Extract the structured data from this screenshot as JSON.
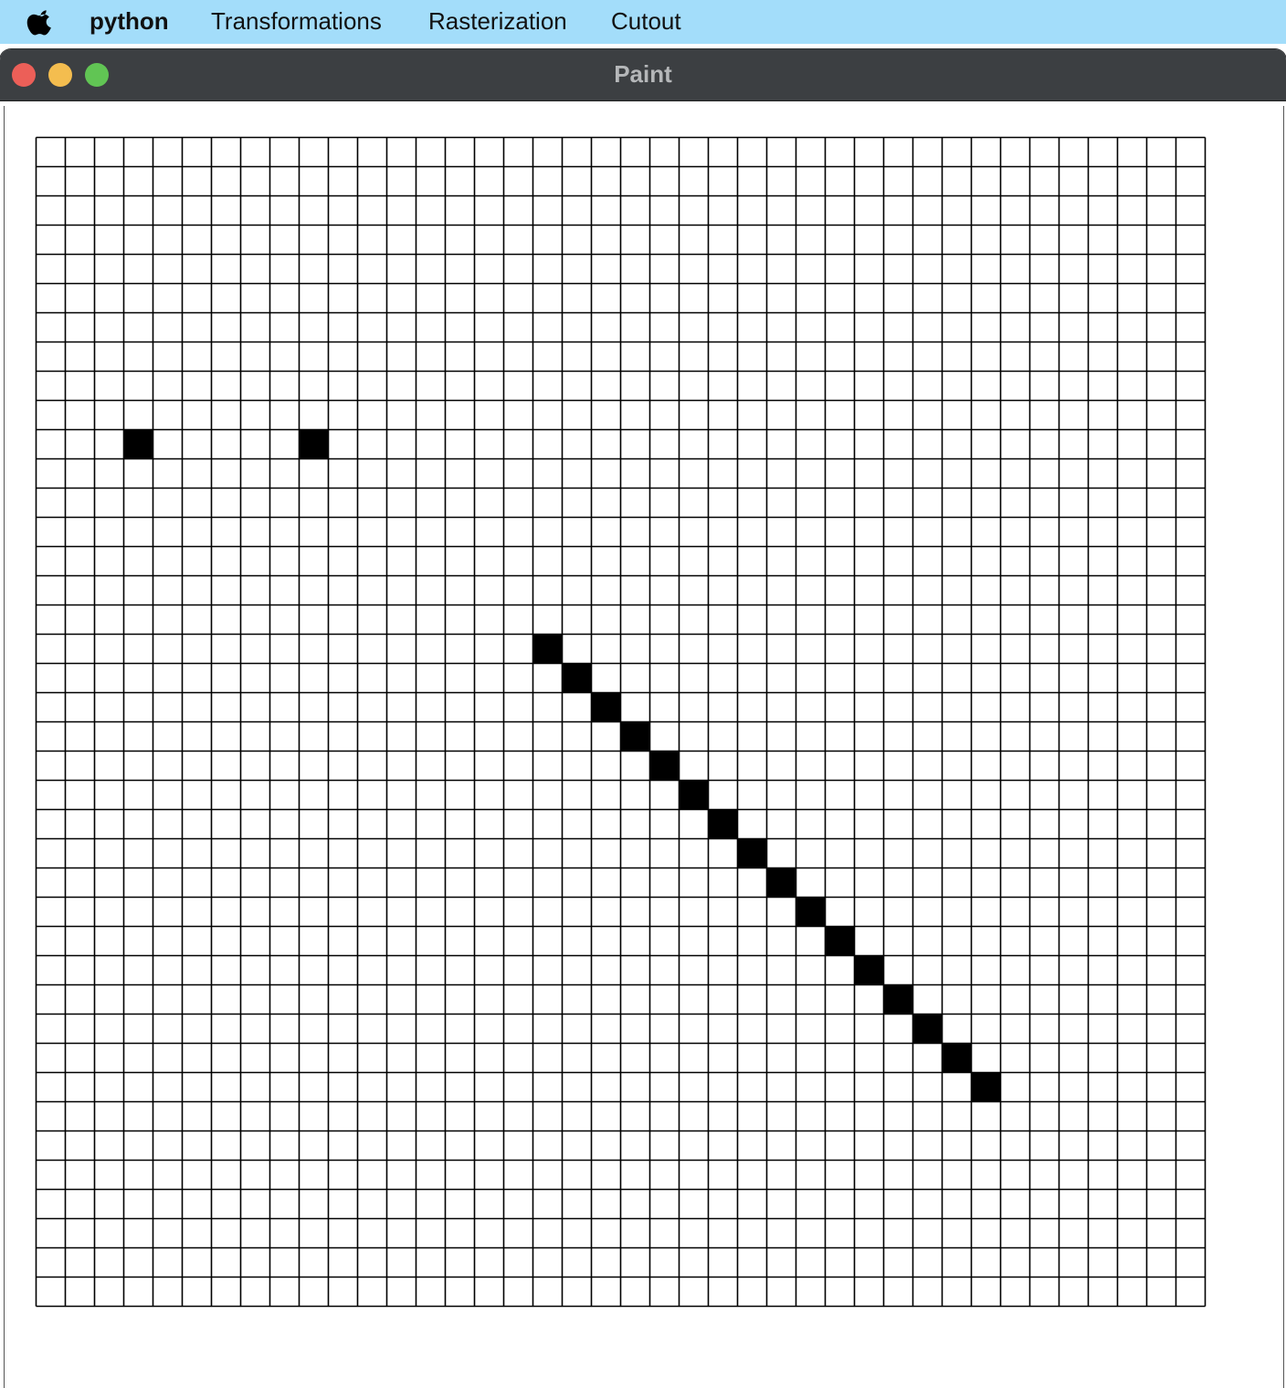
{
  "menubar": {
    "apple_icon": "apple-logo-icon",
    "app_name": "python",
    "menus": [
      "Transformations",
      "Rasterization",
      "Cutout"
    ]
  },
  "window": {
    "title": "Paint",
    "traffic_lights": {
      "close_color": "#ec5f58",
      "minimize_color": "#f4bd4f",
      "maximize_color": "#61c554"
    }
  },
  "canvas": {
    "grid_columns": 40,
    "grid_rows": 40,
    "background_color": "#ffffff",
    "grid_line_color": "#000000",
    "fill_color": "#000000",
    "filled_cells": [
      {
        "col": 3,
        "row": 10
      },
      {
        "col": 9,
        "row": 10
      },
      {
        "col": 17,
        "row": 17
      },
      {
        "col": 18,
        "row": 18
      },
      {
        "col": 19,
        "row": 19
      },
      {
        "col": 20,
        "row": 20
      },
      {
        "col": 21,
        "row": 21
      },
      {
        "col": 22,
        "row": 22
      },
      {
        "col": 23,
        "row": 23
      },
      {
        "col": 24,
        "row": 24
      },
      {
        "col": 25,
        "row": 25
      },
      {
        "col": 26,
        "row": 26
      },
      {
        "col": 27,
        "row": 27
      },
      {
        "col": 28,
        "row": 28
      },
      {
        "col": 29,
        "row": 29
      },
      {
        "col": 30,
        "row": 30
      },
      {
        "col": 31,
        "row": 31
      },
      {
        "col": 32,
        "row": 32
      }
    ]
  }
}
